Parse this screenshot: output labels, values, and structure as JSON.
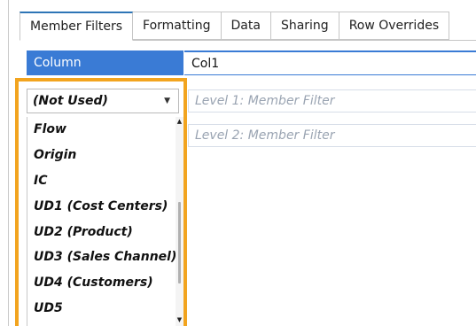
{
  "tabs": [
    {
      "label": "Member Filters",
      "active": true
    },
    {
      "label": "Formatting",
      "active": false
    },
    {
      "label": "Data",
      "active": false
    },
    {
      "label": "Sharing",
      "active": false
    },
    {
      "label": "Row Overrides",
      "active": false
    }
  ],
  "column": {
    "label": "Column",
    "value": "Col1"
  },
  "dimension_select": {
    "selected": "(Not Used)",
    "options": [
      "Flow",
      "Origin",
      "IC",
      "UD1 (Cost Centers)",
      "UD2 (Product)",
      "UD3 (Sales Channel)",
      "UD4 (Customers)",
      "UD5"
    ]
  },
  "member_filters": {
    "level1_placeholder": "Level 1: Member Filter",
    "level2_placeholder": "Level 2: Member Filter"
  },
  "colors": {
    "accent_blue": "#3a7bd5",
    "highlight_orange": "#f2a41f",
    "placeholder_gray": "#9aa4b2"
  },
  "icons": {
    "select_arrow": "triangle-down-icon",
    "scroll_up": "triangle-up-icon",
    "scroll_down": "triangle-down-icon"
  }
}
